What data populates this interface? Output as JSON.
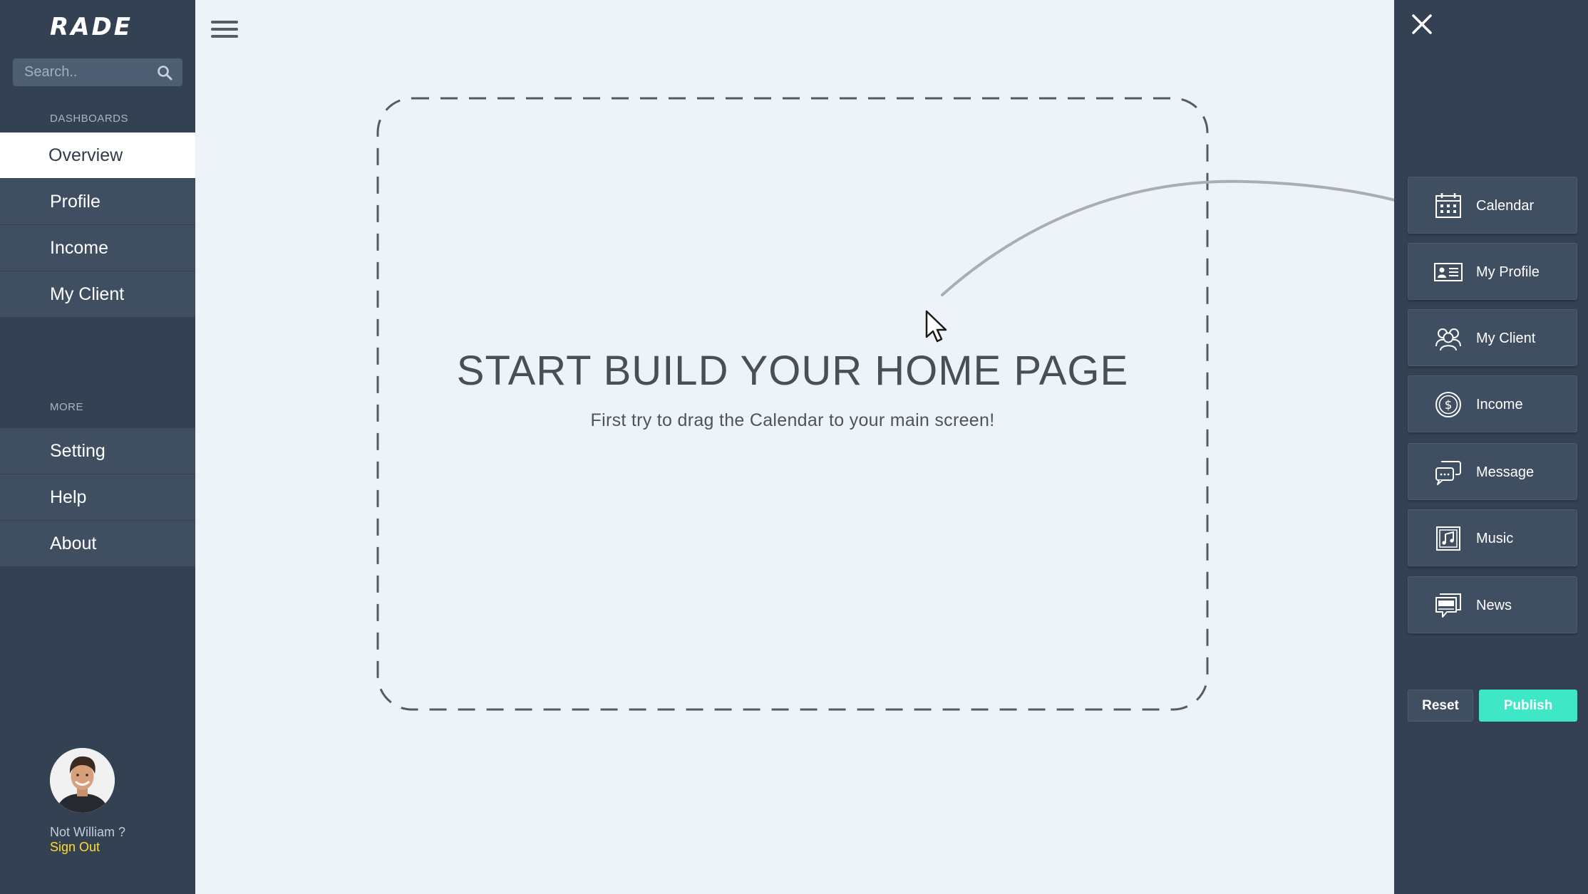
{
  "app": {
    "logo": "RADE"
  },
  "search": {
    "placeholder": "Search.."
  },
  "sidebar": {
    "dashboards_label": "DASHBOARDS",
    "dashboard_items": [
      {
        "label": "Overview",
        "active": true
      },
      {
        "label": "Profile"
      },
      {
        "label": "Income"
      },
      {
        "label": "My Client"
      }
    ],
    "more_label": "MORE",
    "more_items": [
      {
        "label": "Setting"
      },
      {
        "label": "Help"
      },
      {
        "label": "About"
      }
    ]
  },
  "user": {
    "prompt": "Not William ?",
    "signout": "Sign Out"
  },
  "main": {
    "title": "START BUILD YOUR HOME PAGE",
    "subtitle": "First try to drag the Calendar to your main screen!"
  },
  "widgets": [
    {
      "label": "Calendar",
      "icon": "calendar-icon"
    },
    {
      "label": "My Profile",
      "icon": "id-card-icon"
    },
    {
      "label": "My Client",
      "icon": "users-icon"
    },
    {
      "label": "Income",
      "icon": "dollar-coin-icon"
    },
    {
      "label": "Message",
      "icon": "message-icon"
    },
    {
      "label": "Music",
      "icon": "music-icon"
    },
    {
      "label": "News",
      "icon": "news-icon"
    }
  ],
  "actions": {
    "reset": "Reset",
    "publish": "Publish"
  },
  "colors": {
    "sidebar_bg": "#334153",
    "nav_item_bg": "#3f4e61",
    "main_bg": "#eef3f9",
    "accent_publish": "#3ee8c6",
    "signout": "#ffdc2e"
  }
}
